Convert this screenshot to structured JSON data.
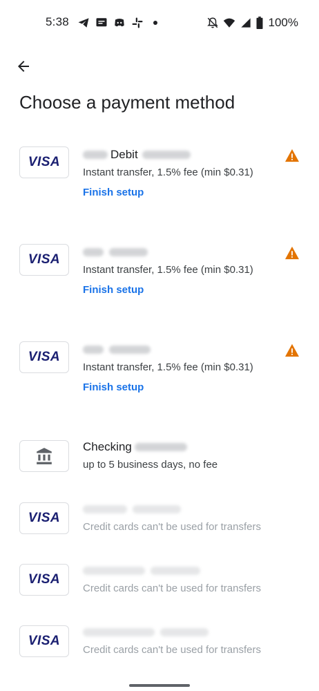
{
  "status_bar": {
    "time": "5:38",
    "battery": "100%",
    "left_icons": [
      "telegram-icon",
      "messages-icon",
      "discord-icon",
      "slack-icon"
    ],
    "right_icons": [
      "bell-off-icon",
      "wifi-icon",
      "cell-signal-icon",
      "battery-icon"
    ]
  },
  "header": {
    "back_icon": "arrow-left-icon",
    "title": "Choose a payment method"
  },
  "methods": [
    {
      "icon": "visa",
      "title_visible": "Debit",
      "subtitle": "Instant transfer, 1.5% fee (min $0.31)",
      "action": "Finish setup",
      "warning": true
    },
    {
      "icon": "visa",
      "title_visible": "",
      "subtitle": "Instant transfer, 1.5% fee (min $0.31)",
      "action": "Finish setup",
      "warning": true
    },
    {
      "icon": "visa",
      "title_visible": "",
      "subtitle": "Instant transfer, 1.5% fee (min $0.31)",
      "action": "Finish setup",
      "warning": true
    },
    {
      "icon": "bank",
      "title_visible": "Checking",
      "subtitle": "up to 5 business days, no fee",
      "action": "",
      "warning": false
    },
    {
      "icon": "visa",
      "title_visible": "",
      "subtitle": "Credit cards can't be used for transfers",
      "action": "",
      "warning": false
    },
    {
      "icon": "visa",
      "title_visible": "",
      "subtitle": "Credit cards can't be used for transfers",
      "action": "",
      "warning": false
    },
    {
      "icon": "visa",
      "title_visible": "",
      "subtitle": "Credit cards can't be used for transfers",
      "action": "",
      "warning": false
    }
  ],
  "visa_label": "VISA",
  "colors": {
    "link": "#1a73e8",
    "warning": "#e37400",
    "visa_blue": "#1a1f71",
    "bank_icon": "#5f6368",
    "disabled_text": "#9aa0a6"
  }
}
